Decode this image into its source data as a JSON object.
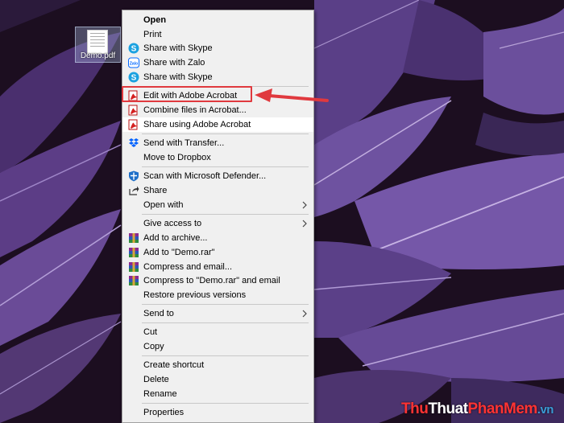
{
  "desktop": {
    "file_icon_label": "Demo.pdf",
    "colors": {
      "background": "#1a0d1d",
      "leaf": "#6b4f9c",
      "leaf_dark": "#3e2a5e",
      "vein": "#b9a4d8"
    }
  },
  "menu": {
    "open": "Open",
    "print": "Print",
    "share_skype_1": "Share with Skype",
    "share_zalo": "Share with Zalo",
    "share_skype_2": "Share with Skype",
    "edit_acrobat": "Edit with Adobe Acrobat",
    "combine_acrobat": "Combine files in Acrobat...",
    "share_acrobat": "Share using Adobe Acrobat",
    "send_transfer": "Send with Transfer...",
    "move_dropbox": "Move to Dropbox",
    "scan_defender": "Scan with Microsoft Defender...",
    "share": "Share",
    "open_with": "Open with",
    "give_access": "Give access to",
    "add_archive": "Add to archive...",
    "add_rar": "Add to \"Demo.rar\"",
    "compress_email": "Compress and email...",
    "compress_rar_email": "Compress to \"Demo.rar\" and email",
    "restore_versions": "Restore previous versions",
    "send_to": "Send to",
    "cut": "Cut",
    "copy": "Copy",
    "create_shortcut": "Create shortcut",
    "delete": "Delete",
    "rename": "Rename",
    "properties": "Properties"
  },
  "icons": {
    "skype": "skype-icon",
    "zalo": "zalo-icon",
    "acrobat": "acrobat-icon",
    "dropbox": "dropbox-icon",
    "defender": "defender-icon",
    "share": "share-icon",
    "winrar": "winrar-icon",
    "submenu": "chevron-right-icon"
  },
  "annotation": {
    "highlight_color": "#e0393e"
  },
  "watermark": {
    "part1": "Thu",
    "part2": "Thuat",
    "part3": "PhanMem",
    "part4": ".vn"
  }
}
